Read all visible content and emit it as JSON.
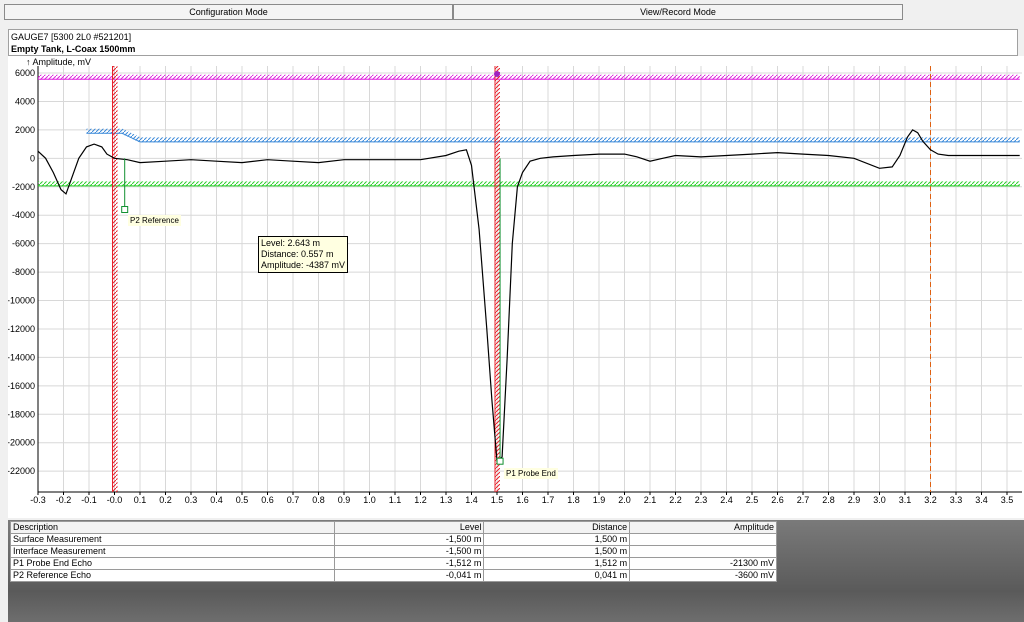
{
  "tabs": [
    {
      "label": "Configuration Mode"
    },
    {
      "label": "View/Record Mode"
    }
  ],
  "header": {
    "device": "GAUGE7 [5300 2L0 #521201]",
    "title": "Empty Tank, L-Coax 1500mm"
  },
  "tooltip": {
    "level": "Level: 2.643 m",
    "distance": "Distance: 0.557 m",
    "amplitude": "Amplitude: -4387 mV"
  },
  "markers": {
    "p1": "P1 Probe End",
    "p2": "P2 Reference"
  },
  "colors": {
    "surface_threshold": "#3c8ad9",
    "interface_threshold": "#2bd02b",
    "upper_reference": "#e020e0",
    "marker_line": "#e8202a",
    "echo_curve": "#000000",
    "cursor_line": "#e06010"
  },
  "table": {
    "headers": [
      "Description",
      "Level",
      "Distance",
      "Amplitude"
    ],
    "rows": [
      [
        "Surface Measurement",
        "-1,500 m",
        "1,500 m",
        ""
      ],
      [
        "Interface Measurement",
        "-1,500 m",
        "1,500 m",
        ""
      ],
      [
        "P1 Probe End Echo",
        "-1,512 m",
        "1,512 m",
        "-21300 mV"
      ],
      [
        "P2 Reference Echo",
        "-0,041 m",
        "0,041 m",
        "-3600 mV"
      ]
    ]
  },
  "chart_data": {
    "type": "line",
    "ylabel": "Amplitude, mV",
    "xlim": [
      -0.3,
      3.55
    ],
    "ylim": [
      -23000,
      6400
    ],
    "y_ticks": [
      6000,
      4000,
      2000,
      0,
      -2000,
      -4000,
      -6000,
      -8000,
      -10000,
      -12000,
      -14000,
      -16000,
      -18000,
      -20000,
      -22000
    ],
    "x_ticks": [
      -0.3,
      -0.2,
      -0.1,
      0,
      0.1,
      0.2,
      0.3,
      0.4,
      0.5,
      0.6,
      0.7,
      0.8,
      0.9,
      1.0,
      1.1,
      1.2,
      1.3,
      1.4,
      1.5,
      1.6,
      1.7,
      1.8,
      1.9,
      2.0,
      2.1,
      2.2,
      2.3,
      2.4,
      2.5,
      2.6,
      2.7,
      2.8,
      2.9,
      3.0,
      3.1,
      3.2,
      3.3,
      3.4,
      3.5
    ],
    "x_tick_labels": [
      "-0.3",
      "-0.2",
      "-0.1",
      "-0.0",
      "0.1",
      "0.2",
      "0.3",
      "0.4",
      "0.5",
      "0.6",
      "0.7",
      "0.8",
      "0.9",
      "1.0",
      "1.1",
      "1.2",
      "1.3",
      "1.4",
      "1.5",
      "1.6",
      "1.7",
      "1.8",
      "1.9",
      "2.0",
      "2.1",
      "2.2",
      "2.3",
      "2.4",
      "2.5",
      "2.6",
      "2.7",
      "2.8",
      "2.9",
      "3.0",
      "3.1",
      "3.2",
      "3.3",
      "3.4",
      "3.5"
    ],
    "grid": true,
    "echo_curve": {
      "x": [
        -0.3,
        -0.27,
        -0.24,
        -0.21,
        -0.19,
        -0.17,
        -0.14,
        -0.11,
        -0.08,
        -0.05,
        -0.03,
        0.0,
        0.05,
        0.1,
        0.2,
        0.3,
        0.4,
        0.5,
        0.6,
        0.7,
        0.8,
        0.9,
        1.0,
        1.1,
        1.2,
        1.3,
        1.35,
        1.38,
        1.4,
        1.43,
        1.46,
        1.48,
        1.5,
        1.52,
        1.54,
        1.56,
        1.58,
        1.6,
        1.63,
        1.67,
        1.72,
        1.8,
        1.9,
        2.0,
        2.05,
        2.1,
        2.15,
        2.2,
        2.3,
        2.4,
        2.5,
        2.6,
        2.7,
        2.8,
        2.9,
        3.0,
        3.05,
        3.08,
        3.11,
        3.13,
        3.15,
        3.17,
        3.2,
        3.23,
        3.27,
        3.3,
        3.4,
        3.5,
        3.55
      ],
      "y": [
        500,
        0,
        -1000,
        -2200,
        -2500,
        -1500,
        0,
        800,
        1000,
        800,
        300,
        0,
        -100,
        -300,
        -200,
        -100,
        -200,
        -300,
        -100,
        -200,
        -300,
        -100,
        -100,
        -100,
        -100,
        200,
        500,
        600,
        -500,
        -5000,
        -12000,
        -17000,
        -21300,
        -21000,
        -14000,
        -6000,
        -2000,
        -1000,
        -200,
        0,
        100,
        200,
        300,
        300,
        100,
        -200,
        0,
        200,
        100,
        200,
        300,
        400,
        300,
        200,
        0,
        -700,
        -600,
        200,
        1500,
        2000,
        1800,
        1200,
        600,
        300,
        200,
        200,
        200,
        200,
        200
      ],
      "color": "#000000"
    },
    "threshold_lines": [
      {
        "x": [
          -0.11,
          0.03,
          0.1,
          3.55
        ],
        "y": [
          1900,
          1900,
          1300,
          1300
        ],
        "color": "#3c8ad9"
      },
      {
        "x": [
          -0.3,
          3.55
        ],
        "y": [
          -1800,
          -1800
        ],
        "color": "#2bd02b"
      },
      {
        "x": [
          -0.3,
          3.55
        ],
        "y": [
          5700,
          5700
        ],
        "color": "#e020e0"
      }
    ],
    "vertical_markers": [
      {
        "x": 0.0,
        "color": "#e8202a",
        "style": "hatched"
      },
      {
        "x": 1.5,
        "color": "#e8202a",
        "style": "hatched"
      },
      {
        "x": 3.2,
        "color": "#e06010",
        "style": "dashed"
      }
    ],
    "echo_markers": [
      {
        "label": "P2 Reference",
        "x": 0.04,
        "y": -3600
      },
      {
        "label": "P1 Probe End",
        "x": 1.512,
        "y": -21300
      }
    ]
  }
}
